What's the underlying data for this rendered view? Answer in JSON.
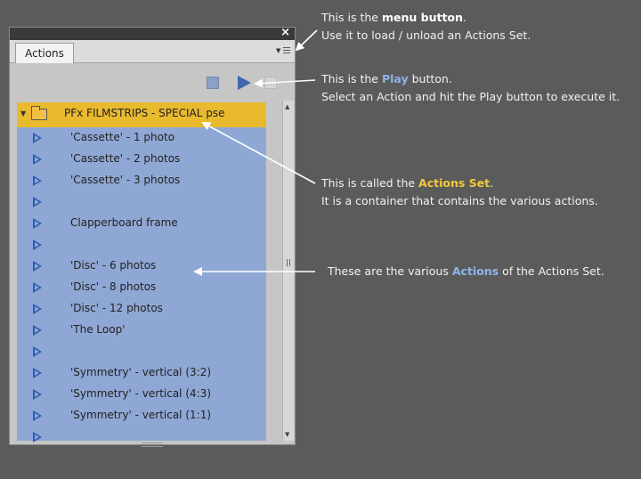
{
  "panel": {
    "close_glyph": "×",
    "tab_label": "Actions",
    "scroll_up_glyph": "▲",
    "scroll_down_glyph": "▼",
    "caret_glyph": "▼",
    "menu_arrow_glyph": "▼",
    "icons": {
      "menu": "menu-lines-icon",
      "stop": "stop-square-icon",
      "play": "play-triangle-icon",
      "record": "record-square-icon",
      "folder": "folder-icon",
      "action": "action-triangle-icon"
    }
  },
  "actions_set": {
    "label": "PFx FILMSTRIPS - SPECIAL pse"
  },
  "actions": [
    "'Cassette' - 1 photo",
    "'Cassette' - 2 photos",
    "'Cassette' - 3 photos",
    "",
    "Clapperboard frame",
    "",
    "'Disc' - 6 photos",
    "'Disc' - 8 photos",
    "'Disc' - 12 photos",
    "'The Loop'",
    "",
    "'Symmetry' - vertical (3:2)",
    "'Symmetry' - vertical (4:3)",
    "'Symmetry' - vertical (1:1)",
    ""
  ],
  "annotations": {
    "menu": {
      "prefix": "This is the ",
      "highlight": "menu button",
      "suffix": ".",
      "line2": "Use it to load / unload an Actions Set."
    },
    "play": {
      "prefix": "This is the ",
      "highlight": "Play",
      "suffix": " button.",
      "line2": "Select an Action and hit the Play button to execute it."
    },
    "set": {
      "prefix": "This is called the ",
      "highlight": "Actions Set",
      "suffix": ".",
      "line2": "It is a container that contains the various actions."
    },
    "actions": {
      "prefix": "These are the various ",
      "highlight": "Actions",
      "suffix": " of the Actions Set."
    }
  },
  "colors": {
    "background": "#5b5b5b",
    "list_background": "#8fa7d4",
    "actions_set_highlight": "#e9b92e",
    "play_blue": "#3f68b0",
    "highlight_blue_text": "#8fb4ea",
    "highlight_yellow_text": "#f0c93a"
  }
}
